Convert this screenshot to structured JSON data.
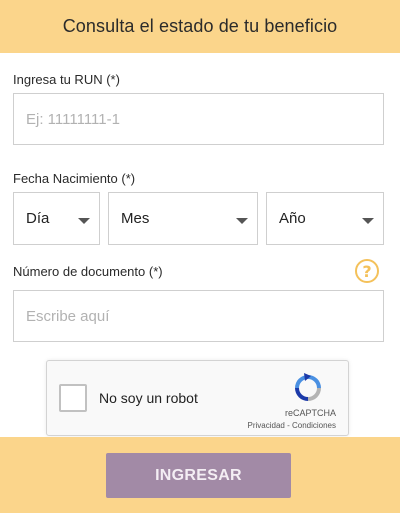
{
  "header": {
    "title": "Consulta el estado de tu beneficio"
  },
  "run": {
    "label": "Ingresa tu RUN",
    "required": "(*)",
    "placeholder": "Ej: 11111111-1"
  },
  "birth": {
    "label": "Fecha Nacimiento",
    "required": "(*)",
    "day": "Día",
    "month": "Mes",
    "year": "Año"
  },
  "document": {
    "label": "Número de documento",
    "required": "(*)",
    "placeholder": "Escribe aquí",
    "help_icon": "question-circle-icon",
    "help_symbol": "?"
  },
  "captcha": {
    "checkbox_label": "No soy un robot",
    "brand": "reCAPTCHA",
    "privacy": "Privacidad",
    "separator": " - ",
    "terms": "Condiciones",
    "logo_icon": "recaptcha-logo-icon"
  },
  "submit": {
    "label": "INGRESAR"
  },
  "colors": {
    "accent": "#fbd58b",
    "button": "#a28aa6",
    "help": "#f4c15a"
  }
}
